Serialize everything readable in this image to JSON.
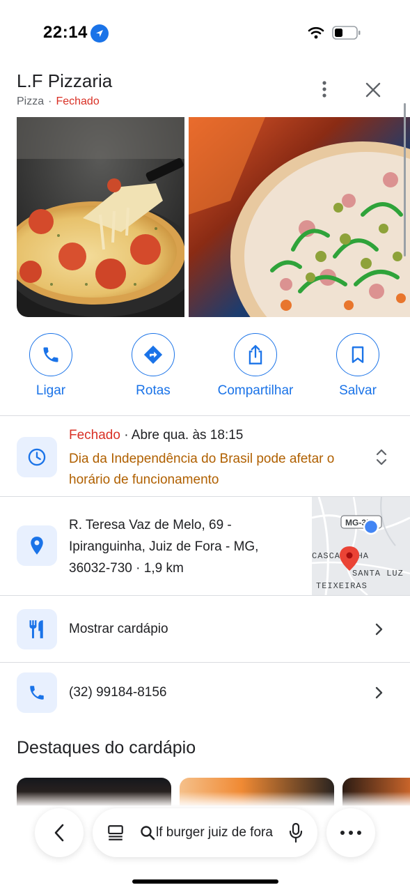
{
  "status_bar": {
    "time": "22:14"
  },
  "place": {
    "name": "L.F Pizzaria",
    "category": "Pizza",
    "separator": "·",
    "status": "Fechado"
  },
  "actions": [
    {
      "label": "Ligar",
      "icon": "phone-icon"
    },
    {
      "label": "Rotas",
      "icon": "directions-icon"
    },
    {
      "label": "Compartilhar",
      "icon": "share-icon"
    },
    {
      "label": "Salvar",
      "icon": "bookmark-icon"
    }
  ],
  "hours": {
    "status": "Fechado",
    "opens": " · Abre qua. às 18:15",
    "warning": "Dia da Independência do Brasil pode afetar o horário de funcionamento"
  },
  "address": {
    "text": "R. Teresa Vaz de Melo, 69 - Ipiranguinha, Juiz de Fora - MG, 36032-730",
    "distance": " · 1,9 km"
  },
  "map": {
    "road_label": "MG-353",
    "labels": [
      "CASCATINHA",
      "SANTA LUZ",
      "TEIXEIRAS"
    ]
  },
  "menu_row": {
    "label": "Mostrar cardápio"
  },
  "phone_row": {
    "label": "(32) 99184-8156"
  },
  "menu_highlights": {
    "title": "Destaques do cardápio"
  },
  "search": {
    "query": "lf burger juiz de fora"
  },
  "colors": {
    "accent": "#1a73e8",
    "closed": "#d93025",
    "warning": "#b06000",
    "icon_bg": "#e8f0fe"
  }
}
